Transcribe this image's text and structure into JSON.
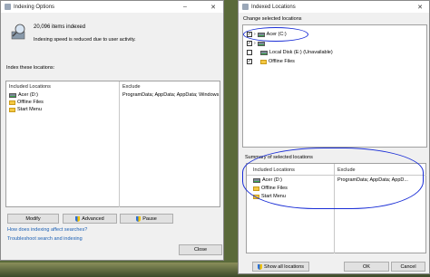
{
  "indexing_options": {
    "title": "Indexing Options",
    "items_indexed": "20,096 items indexed",
    "status": "Indexing speed is reduced due to user activity.",
    "index_these_locations": "Index these locations:",
    "col_included": "Included Locations",
    "col_exclude": "Exclude",
    "rows": [
      {
        "name": "Acer (D:)",
        "exclude": "ProgramData; AppData; AppData; Windows"
      },
      {
        "name": "Offline Files",
        "exclude": ""
      },
      {
        "name": "Start Menu",
        "exclude": ""
      }
    ],
    "buttons": {
      "modify": "Modify",
      "advanced": "Advanced",
      "pause": "Pause",
      "close": "Close"
    },
    "links": {
      "how": "How does indexing affect searches?",
      "troubleshoot": "Troubleshoot search and indexing"
    }
  },
  "indexed_locations": {
    "title": "Indexed Locations",
    "change_label": "Change selected locations",
    "tree": [
      {
        "name": "Acer (C:)",
        "checked": true,
        "type": "drive"
      },
      {
        "name": "",
        "checked": true,
        "type": "drive"
      },
      {
        "name": "Local Disk (E:) (Unavailable)",
        "checked": false,
        "type": "drive"
      },
      {
        "name": "Offline Files",
        "checked": true,
        "type": "folder"
      }
    ],
    "summary_label": "Summary of selected locations",
    "col_included": "Included Locations",
    "col_exclude": "Exclude",
    "summary_rows": [
      {
        "name": "Acer (D:)",
        "exclude": "ProgramData; AppData; AppD..."
      },
      {
        "name": "Offline Files",
        "exclude": ""
      },
      {
        "name": "Start Menu",
        "exclude": ""
      }
    ],
    "buttons": {
      "show_all": "Show all locations",
      "ok": "OK",
      "cancel": "Cancel"
    }
  },
  "colors": {
    "annotation_ink": "#1a2ed6",
    "link": "#1a5fb4"
  }
}
